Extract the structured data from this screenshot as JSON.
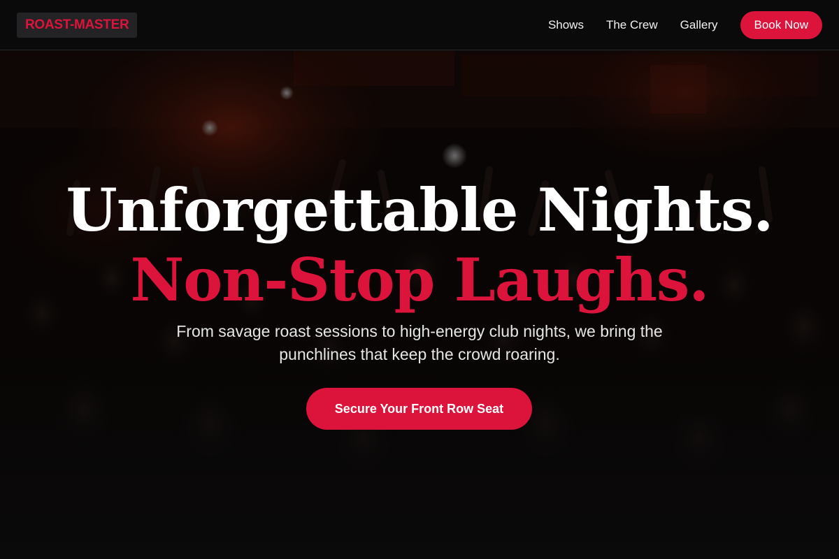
{
  "brand": {
    "logo_text": "ROAST-MASTER"
  },
  "nav": {
    "links": [
      "Shows",
      "The Crew",
      "Gallery"
    ],
    "book_label": "Book Now"
  },
  "hero": {
    "headline_line1": "Unforgettable Nights.",
    "headline_line2": "Non-Stop Laughs.",
    "subtitle": "From savage roast sessions to high-energy club nights, we bring the punchlines that keep the crowd roaring.",
    "cta_label": "Secure Your Front Row Seat",
    "background_image": "concert-crowd-photo"
  },
  "colors": {
    "accent": "#dc143c",
    "nav_background": "#0a0a0b",
    "logo_chip": "#232325",
    "page_background": "#0b0b0c",
    "headline": "#ffffff",
    "subtitle": "#e6e6e6"
  }
}
